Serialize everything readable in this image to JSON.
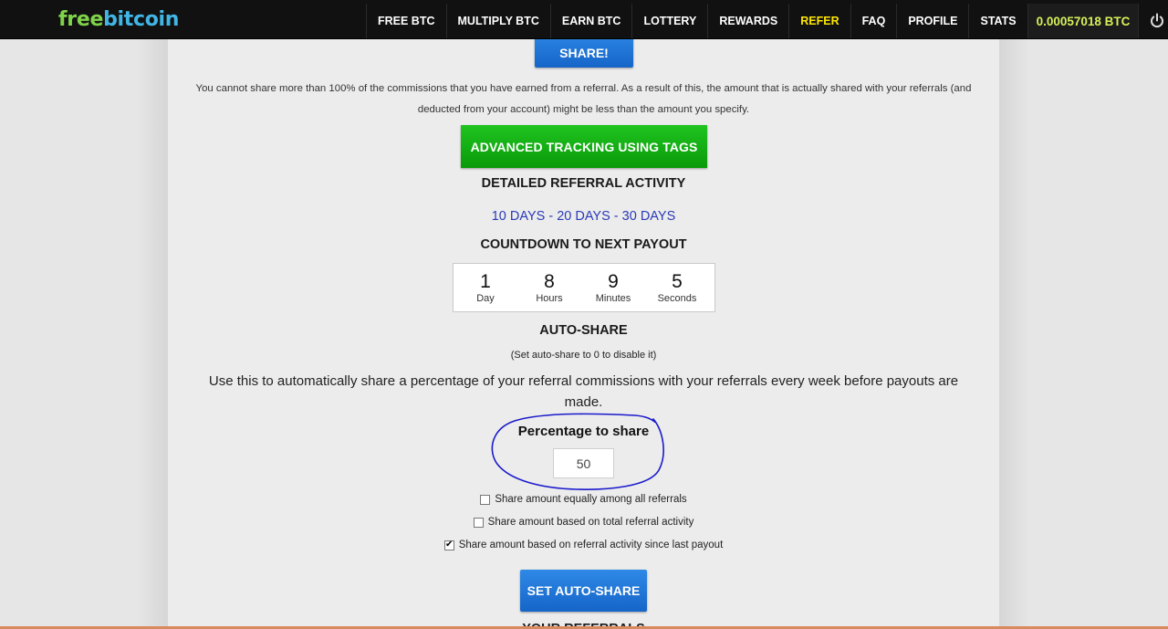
{
  "logo": {
    "part1": "free",
    "part2": "bitcoin"
  },
  "nav": {
    "items": [
      "FREE BTC",
      "MULTIPLY BTC",
      "EARN BTC",
      "LOTTERY",
      "REWARDS",
      "REFER",
      "FAQ",
      "PROFILE",
      "STATS"
    ],
    "active": "REFER",
    "balance": "0.00057018 BTC",
    "power_icon": "power-icon"
  },
  "share_button": "SHARE!",
  "notice": "You cannot share more than 100% of the commissions that you have earned from a referral. As a result of this, the amount that is actually shared with your referrals (and deducted from your account) might be less than the amount you specify.",
  "advanced_button": "ADVANCED TRACKING USING TAGS",
  "activity": {
    "title": "DETAILED REFERRAL ACTIVITY",
    "links": [
      "10 DAYS",
      "20 DAYS",
      "30 DAYS"
    ],
    "separator": " - "
  },
  "countdown": {
    "title": "COUNTDOWN TO NEXT PAYOUT",
    "cells": [
      {
        "value": "1",
        "label": "Day"
      },
      {
        "value": "8",
        "label": "Hours"
      },
      {
        "value": "9",
        "label": "Minutes"
      },
      {
        "value": "5",
        "label": "Seconds"
      }
    ]
  },
  "autoshare": {
    "title": "AUTO-SHARE",
    "note": "(Set auto-share to 0 to disable it)",
    "description": "Use this to automatically share a percentage of your referral commissions with your referrals every week before payouts are made.",
    "percentage_label": "Percentage to share",
    "percentage_value": "50",
    "options": [
      {
        "label": "Share amount equally among all referrals",
        "checked": false
      },
      {
        "label": "Share amount based on total referral activity",
        "checked": false
      },
      {
        "label": "Share amount based on referral activity since last payout",
        "checked": true
      }
    ],
    "set_button": "SET AUTO-SHARE",
    "annotation_color": "#1a1acc"
  },
  "referrals_title": "YOUR REFERRALS",
  "colors": {
    "topbar": "#111111",
    "refer_active": "#ffe600",
    "balance": "#d6f05a",
    "blue_button": "#1f74d6",
    "green_button": "#14b014",
    "link": "#2a3ab8"
  }
}
